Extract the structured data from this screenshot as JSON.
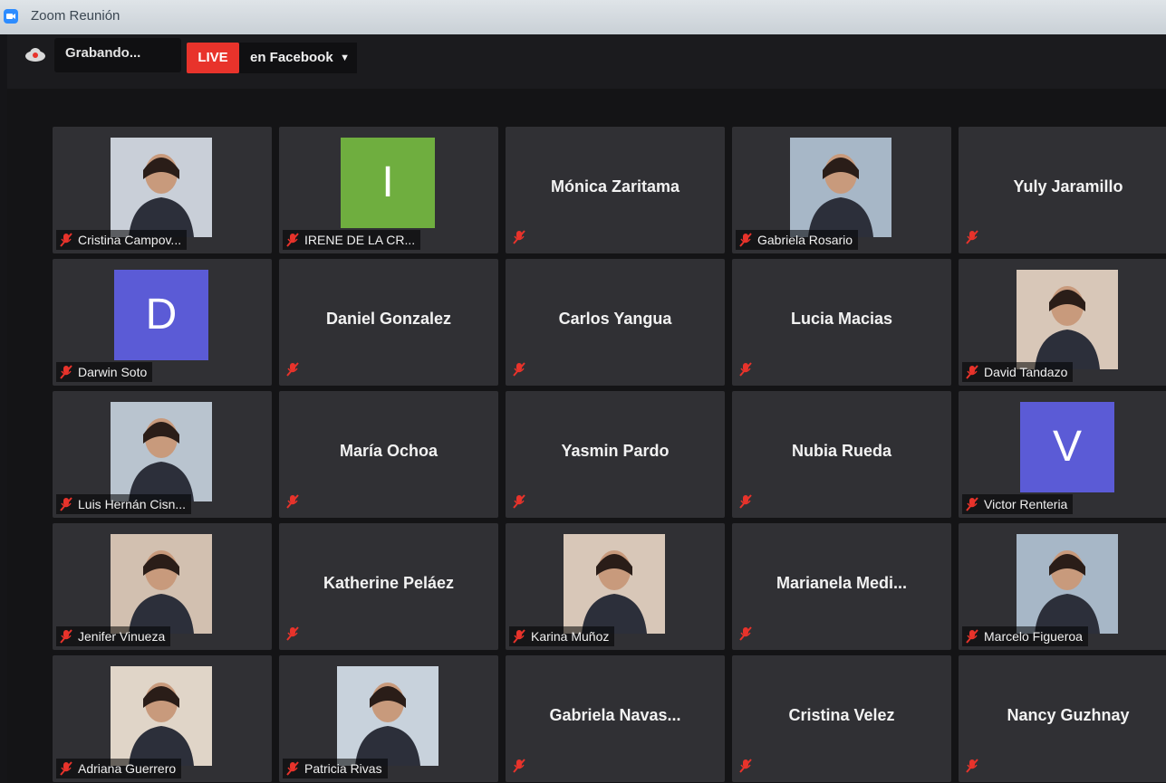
{
  "window": {
    "title": "Zoom Reunión"
  },
  "topbar": {
    "recording_text": "Grabando...",
    "live_badge": "LIVE",
    "live_destination": "en Facebook"
  },
  "participants": [
    {
      "name": "Cristina Campov...",
      "kind": "video"
    },
    {
      "name": "IRENE DE LA CR...",
      "kind": "avatar",
      "initial": "I",
      "color": "#6fae3f"
    },
    {
      "name": "Mónica Zaritama",
      "kind": "name"
    },
    {
      "name": "Gabriela Rosario",
      "kind": "video"
    },
    {
      "name": "Yuly Jaramillo",
      "kind": "name"
    },
    {
      "name": "Darwin Soto",
      "kind": "avatar",
      "initial": "D",
      "color": "#5b5bd6"
    },
    {
      "name": "Daniel Gonzalez",
      "kind": "name"
    },
    {
      "name": "Carlos Yangua",
      "kind": "name"
    },
    {
      "name": "Lucia Macias",
      "kind": "name"
    },
    {
      "name": "David Tandazo",
      "kind": "video"
    },
    {
      "name": "Luis Hernán Cisn...",
      "kind": "video"
    },
    {
      "name": "María Ochoa",
      "kind": "name"
    },
    {
      "name": "Yasmin Pardo",
      "kind": "name"
    },
    {
      "name": "Nubia Rueda",
      "kind": "name"
    },
    {
      "name": "Victor Renteria",
      "kind": "avatar",
      "initial": "V",
      "color": "#5b5bd6"
    },
    {
      "name": "Jenifer Vinueza",
      "kind": "video"
    },
    {
      "name": "Katherine Peláez",
      "kind": "name"
    },
    {
      "name": "Karina Muñoz",
      "kind": "video"
    },
    {
      "name": "Marianela  Medi...",
      "kind": "name"
    },
    {
      "name": "Marcelo Figueroa",
      "kind": "video"
    },
    {
      "name": "Adriana Guerrero",
      "kind": "video"
    },
    {
      "name": "Patricia Rivas",
      "kind": "video"
    },
    {
      "name": "Gabriela  Navas...",
      "kind": "name"
    },
    {
      "name": "Cristina Velez",
      "kind": "name"
    },
    {
      "name": "Nancy Guzhnay",
      "kind": "name"
    }
  ]
}
